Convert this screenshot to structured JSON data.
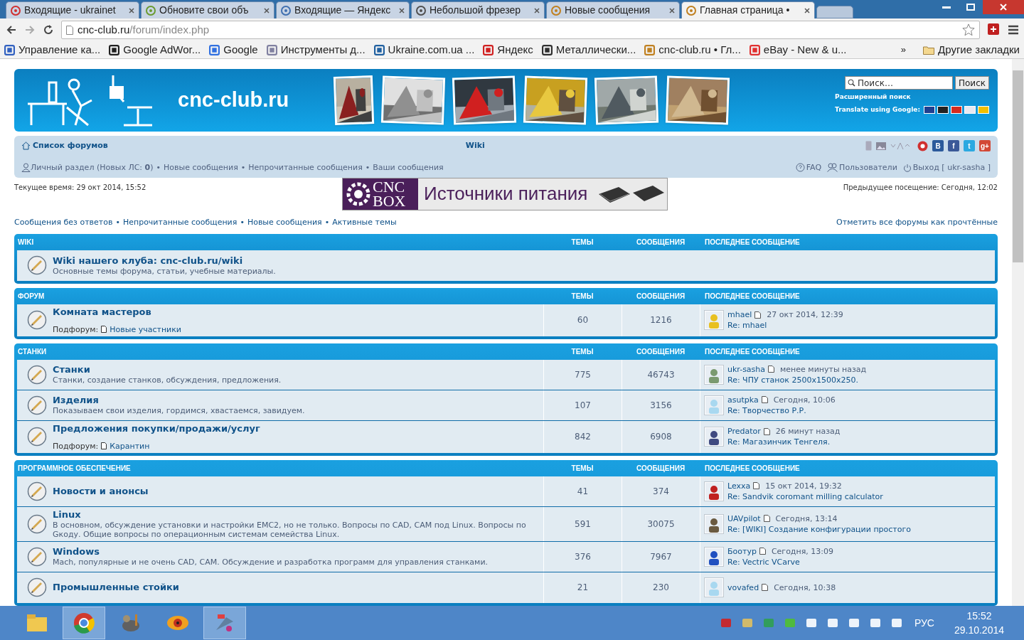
{
  "browser": {
    "tabs": [
      {
        "title": "Входящие - ukrainet",
        "selected": false
      },
      {
        "title": "Обновите свои объ",
        "selected": false
      },
      {
        "title": "Входящие — Яндекс",
        "selected": false
      },
      {
        "title": "Небольшой фрезер",
        "selected": false
      },
      {
        "title": "Новые сообщения",
        "selected": false
      },
      {
        "title": "Главная страница •",
        "selected": true
      }
    ],
    "url_host": "cnc-club.ru",
    "url_path": "/forum/index.php",
    "bookmarks": [
      "Управление ка...",
      "Google AdWor...",
      "Google",
      "Инструменты д...",
      "Ukraine.com.ua ...",
      "Яндекс",
      "Металлически...",
      "cnc-club.ru • Гл...",
      "eBay - New & u..."
    ],
    "more": "»",
    "other_bookmarks": "Другие закладки"
  },
  "header": {
    "site_title": "cnc-club.ru",
    "search_placeholder": "Поиск…",
    "search_button": "Поиск",
    "advanced_search": "Расширенный поиск",
    "translate_label": "Translate using Google:"
  },
  "navbar": {
    "forum_index": "Список форумов",
    "wiki": "Wiki",
    "personal": "Личный раздел (Новых ЛС: **0**)",
    "links": [
      {
        "sep": "•",
        "label": "Новые сообщения"
      },
      {
        "sep": "•",
        "label": "Непрочитанные сообщения"
      },
      {
        "sep": "•",
        "label": "Ваши сообщения"
      }
    ],
    "faq": "FAQ",
    "users": "Пользователи",
    "logout": "Выход [ ukr-sasha ]",
    "social": [
      "В",
      "f",
      "t",
      "g+"
    ]
  },
  "current_time": "Текущее время: 29 окт 2014, 15:52",
  "last_visit": "Предыдущее посещение: Сегодня, 12:02",
  "banner": {
    "logo_top": "CNC",
    "logo_bottom": "BOX",
    "text": "Источники питания"
  },
  "quick_links": [
    {
      "label": "Сообщения без ответов"
    },
    {
      "sep": "•",
      "label": "Непрочитанные сообщения"
    },
    {
      "sep": "•",
      "label": "Новые сообщения"
    },
    {
      "sep": "•",
      "label": "Активные темы"
    }
  ],
  "mark_read": "Отметить все форумы как прочтённые",
  "categories": [
    {
      "name": "WIKI",
      "col_topics": "ТЕМЫ",
      "col_posts": "СООБЩЕНИЯ",
      "col_last": "ПОСЛЕДНЕЕ СООБЩЕНИЕ",
      "forums": [
        {
          "kind": "link",
          "title": "Wiki нашего клуба: cnc-club.ru/wiki",
          "description": "Основные темы форума, статьи, учебные материалы."
        }
      ]
    },
    {
      "name": "ФОРУМ",
      "col_topics": "ТЕМЫ",
      "col_posts": "СООБЩЕНИЯ",
      "col_last": "ПОСЛЕДНЕЕ СООБЩЕНИЕ",
      "forums": [
        {
          "kind": "forum",
          "title": "Комната мастеров",
          "subforum_label": "Подфорум:",
          "subforum": "Новые участники",
          "topics": "60",
          "posts": "1216",
          "author": "mhael",
          "time": "27 окт 2014, 12:39",
          "re": "Re: mhael"
        }
      ]
    },
    {
      "name": "СТАНКИ",
      "col_topics": "ТЕМЫ",
      "col_posts": "СООБЩЕНИЯ",
      "col_last": "ПОСЛЕДНЕЕ СООБЩЕНИЕ",
      "forums": [
        {
          "kind": "forum",
          "title": "Станки",
          "description": "Станки, создание станков, обсуждения, предложения.",
          "topics": "775",
          "posts": "46743",
          "author": "ukr-sasha",
          "time": "менее минуты назад",
          "re": "Re: ЧПУ станок 2500x1500x250."
        },
        {
          "kind": "forum",
          "title": "Изделия",
          "description": "Показываем свои изделия, гордимся, хвастаемся, завидуем.",
          "topics": "107",
          "posts": "3156",
          "author": "asutpka",
          "time": "Сегодня, 10:06",
          "re": "Re: Творчество Р.Р."
        },
        {
          "kind": "forum",
          "title": "Предложения покупки/продажи/услуг",
          "subforum_label": "Подфорум:",
          "subforum": "Карантин",
          "topics": "842",
          "posts": "6908",
          "author": "Predator",
          "time": "26 минут назад",
          "re": "Re: Магазинчик Тенгеля."
        }
      ]
    },
    {
      "name": "ПРОГРАММНОЕ ОБЕСПЕЧЕНИЕ",
      "col_topics": "ТЕМЫ",
      "col_posts": "СООБЩЕНИЯ",
      "col_last": "ПОСЛЕДНЕЕ СООБЩЕНИЕ",
      "forums": [
        {
          "kind": "forum",
          "title": "Новости и анонсы",
          "topics": "41",
          "posts": "374",
          "author": "Lexxa",
          "time": "15 окт 2014, 19:32",
          "re": "Re: Sandvik coromant milling calculator"
        },
        {
          "kind": "forum",
          "title": "Linux",
          "description": "В основном, обсуждение установки и настройки EMC2, но не только. Вопросы по CAD, CAM под Linux. Вопросы по Gкоду. Общие вопросы по операционным системам семейства Linux.",
          "topics": "591",
          "posts": "30075",
          "author": "UAVpilot",
          "time": "Сегодня, 13:14",
          "re": "Re: [WIKI] Создание конфигурации простого"
        },
        {
          "kind": "forum",
          "title": "Windows",
          "description": "Mach, популярные и не очень CAD, CAM. Обсуждение и разработка программ для управления станками.",
          "topics": "376",
          "posts": "7967",
          "author": "Боотур",
          "time": "Сегодня, 13:09",
          "re": "Re: Vectric VCarve"
        },
        {
          "kind": "forum",
          "title": "Промышленные стойки",
          "topics": "21",
          "posts": "230",
          "author": "vovafed",
          "time": "Сегодня, 10:38"
        }
      ]
    }
  ],
  "taskbar": {
    "apps": [
      {
        "selected": false
      },
      {
        "selected": true
      },
      {
        "selected": false
      },
      {
        "selected": false
      },
      {
        "selected": true
      }
    ],
    "language": "РУС",
    "time": "15:52",
    "date": "29.10.2014"
  }
}
